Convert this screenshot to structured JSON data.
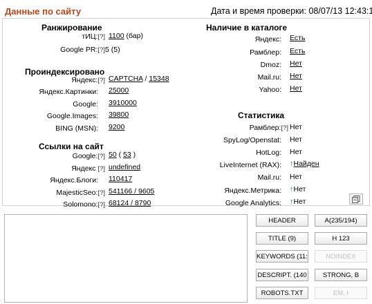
{
  "header": {
    "title": "Данные по сайту",
    "date_label": "Дата и время проверки:",
    "date_value": "08/07/13 12:43:19"
  },
  "q": "[?]",
  "ranking": {
    "title": "Ранжирование",
    "tic": {
      "label": "тИЦ:",
      "value": "1100",
      "suffix": "(бар)"
    },
    "pr": {
      "label": "Google PR:",
      "value": "5 (5)"
    }
  },
  "indexed": {
    "title": "Проиндексировано",
    "yandex": {
      "label": "Яндекс:",
      "value1": "CAPTCHA",
      "sep": "/",
      "value2": "15348"
    },
    "yandex_images": {
      "label": "Яндекс.Картинки:",
      "value": "25000"
    },
    "google": {
      "label": "Google:",
      "value": "3910000"
    },
    "google_images": {
      "label": "Google.Images:",
      "value": "39800"
    },
    "bing": {
      "label": "BING (MSN):",
      "value": "9200"
    }
  },
  "links": {
    "title": "Ссылки на сайт",
    "google": {
      "label": "Google:",
      "value1": "50",
      "value2": "53"
    },
    "yandex": {
      "label": "Яндекс",
      "value": "undefined"
    },
    "yandex_blogs": {
      "label": "Яндекс.Блоги:",
      "value": "110417"
    },
    "majestic": {
      "label": "MajesticSeo:",
      "value": "541166 / 9605"
    },
    "solomono": {
      "label": "Solomono:",
      "value": "68124 / 8790"
    }
  },
  "catalog": {
    "title": "Наличие в каталоге",
    "items": [
      {
        "label": "Яндекс:",
        "value": "Есть"
      },
      {
        "label": "Рамблер:",
        "value": "Есть"
      },
      {
        "label": "Dmoz:",
        "value": "Нет"
      },
      {
        "label": "Mail.ru:",
        "value": "Нет"
      },
      {
        "label": "Yahoo:",
        "value": "Нет"
      }
    ]
  },
  "stats": {
    "title": "Статистика",
    "rambler": {
      "label": "Рамблер:",
      "value": "Нет"
    },
    "spylog": {
      "label": "SpyLog/Openstat:",
      "value": "Нет"
    },
    "hotlog": {
      "label": "HotLog:",
      "value": "Нет"
    },
    "liveinternet": {
      "label": "LiveInternet (RAX):",
      "value": "Найден"
    },
    "mailru": {
      "label": "Mail.ru:",
      "value": "Нет"
    },
    "metrika": {
      "label": "Яндекс.Метрика:",
      "value": "Нет"
    },
    "analytics": {
      "label": "Google Analytics:",
      "value": "Нет"
    }
  },
  "buttons": {
    "header": "HEADER",
    "a": "A(235/194)",
    "title": "TITLE (9)",
    "h": "H 123",
    "keywords": "KEYWORDS (11:",
    "noindex": "NOINDEX",
    "description": "DESCRIPT. (140",
    "strong": "STRONG, B",
    "robots": "ROBOTS.TXT",
    "em": "EM, I"
  },
  "colors": {
    "title": "#b8461c",
    "arrow": "#0a8f2a",
    "border": "#d2d2d2"
  }
}
